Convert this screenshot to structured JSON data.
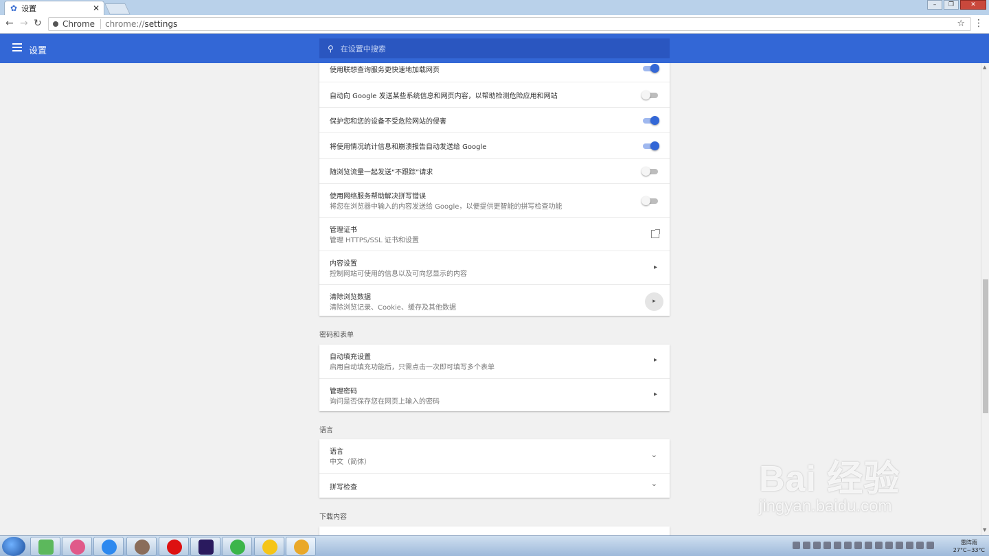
{
  "browser": {
    "tab_title": "设置",
    "omnibox_chip": "Chrome",
    "url_prefix": "chrome://",
    "url_path": "settings"
  },
  "header": {
    "title": "设置",
    "search_placeholder": "在设置中搜索"
  },
  "privacy_rows": [
    {
      "label": "使用联想查询服务更快速地加载网页",
      "toggle": "on"
    },
    {
      "label": "自动向 Google 发送某些系统信息和网页内容，以帮助检测危险应用和网站",
      "toggle": "off"
    },
    {
      "label": "保护您和您的设备不受危险网站的侵害",
      "toggle": "on"
    },
    {
      "label": "将使用情况统计信息和崩溃报告自动发送给 Google",
      "toggle": "on"
    },
    {
      "label": "随浏览流量一起发送“不跟踪”请求",
      "toggle": "off"
    },
    {
      "label": "使用网络服务帮助解决拼写错误",
      "sub": "将您在浏览器中输入的内容发送给 Google，以便提供更智能的拼写检查功能",
      "toggle": "off"
    },
    {
      "label": "管理证书",
      "sub": "管理 HTTPS/SSL 证书和设置",
      "icon": "open-in-new-icon"
    },
    {
      "label": "内容设置",
      "sub": "控制网站可使用的信息以及可向您显示的内容",
      "icon": "arrow-right-icon"
    },
    {
      "label": "清除浏览数据",
      "sub": "清除浏览记录、Cookie、缓存及其他数据",
      "icon": "arrow-right-icon"
    }
  ],
  "passwords_section": {
    "title": "密码和表单",
    "rows": [
      {
        "label": "自动填充设置",
        "sub": "启用自动填充功能后，只需点击一次即可填写多个表单"
      },
      {
        "label": "管理密码",
        "sub": "询问是否保存您在网页上输入的密码"
      }
    ]
  },
  "language_section": {
    "title": "语言",
    "rows": [
      {
        "label": "语言",
        "sub": "中文（简体）"
      },
      {
        "label": "拼写检查"
      }
    ]
  },
  "downloads_section": {
    "title": "下载内容"
  },
  "watermark": {
    "brand": "Bai 经验",
    "url": "jingyan.baidu.com"
  },
  "taskbar": {
    "weather": "雷阵雨",
    "temp": "27°C~33°C",
    "colors": [
      "#5cb85c",
      "#e05a8a",
      "#2d89ef",
      "#8a6d5a",
      "#d11",
      "#2a1a5e",
      "#3bb54a",
      "#f5c518",
      "#e9a82a"
    ]
  },
  "colors": {
    "accent": "#3367d6",
    "header_search": "#2a56c0"
  }
}
